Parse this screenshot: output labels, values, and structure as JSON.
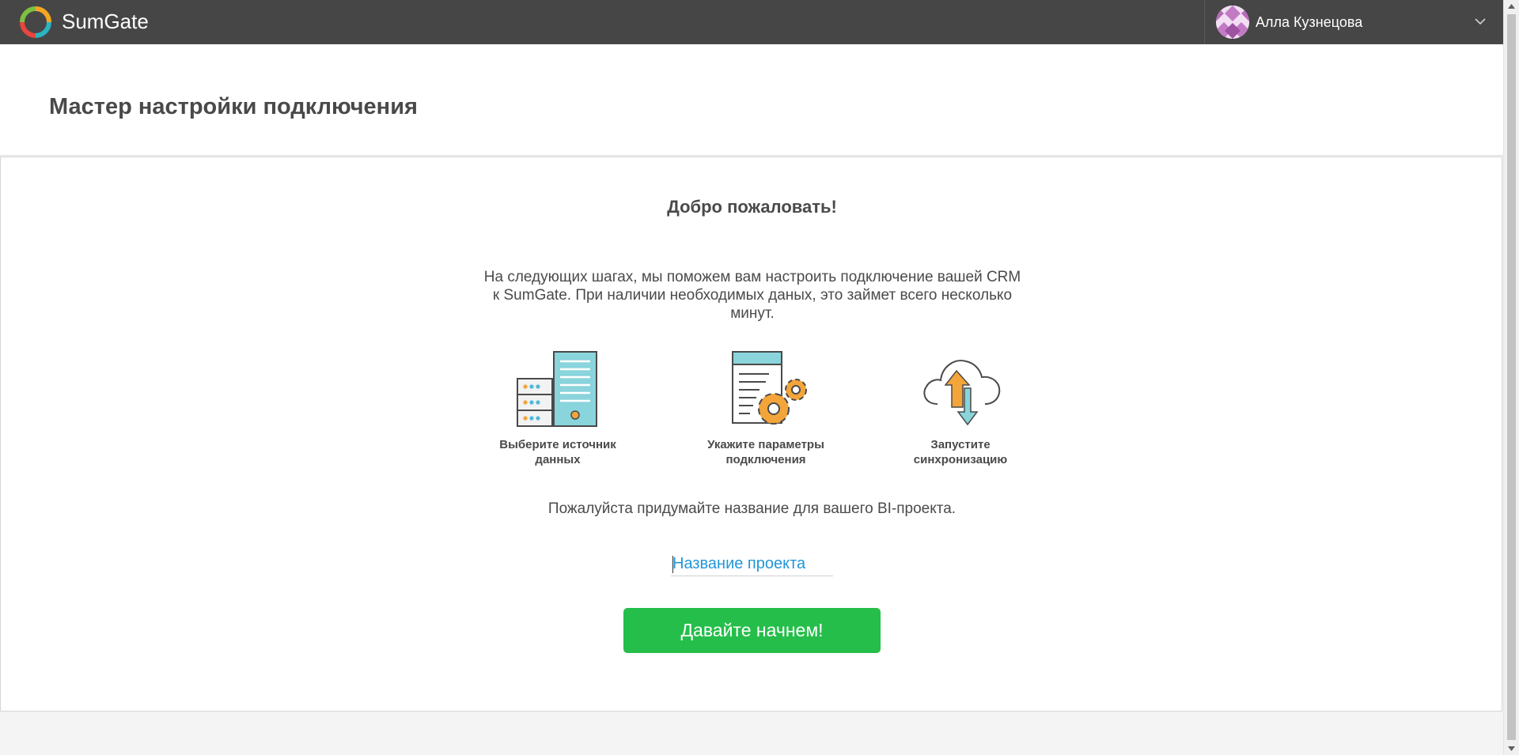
{
  "app": {
    "brand": "SumGate",
    "icons": {
      "logo": "sumgate-ring-logo",
      "menu": "chevron-down-icon"
    }
  },
  "user": {
    "name": "Алла Кузнецова"
  },
  "header": {
    "title": "Мастер настройки подключения"
  },
  "wizard": {
    "welcome": "Добро пожаловать!",
    "intro": "На следующих шагах, мы поможем вам настроить подключение вашей CRM к SumGate. При наличии необходимых даных, это займет всего несколько минут.",
    "steps": [
      {
        "icon": "server-rack-icon",
        "line1": "Выберите источник",
        "line2": "данных"
      },
      {
        "icon": "document-gears-icon",
        "line1": "Укажите параметры",
        "line2": "подключения"
      },
      {
        "icon": "cloud-sync-icon",
        "line1": "Запустите",
        "line2": "синхронизацию"
      }
    ],
    "prompt": "Пожалуйста придумайте название для вашего BI-проекта.",
    "project_name": {
      "value": "",
      "placeholder": "Название проекта"
    },
    "start_label": "Давайте начнем!"
  },
  "colors": {
    "topbar": "#464646",
    "accent_green": "#25be4a",
    "link_blue": "#2196d8",
    "teal": "#8ad4dc",
    "orange": "#f4a53a"
  }
}
